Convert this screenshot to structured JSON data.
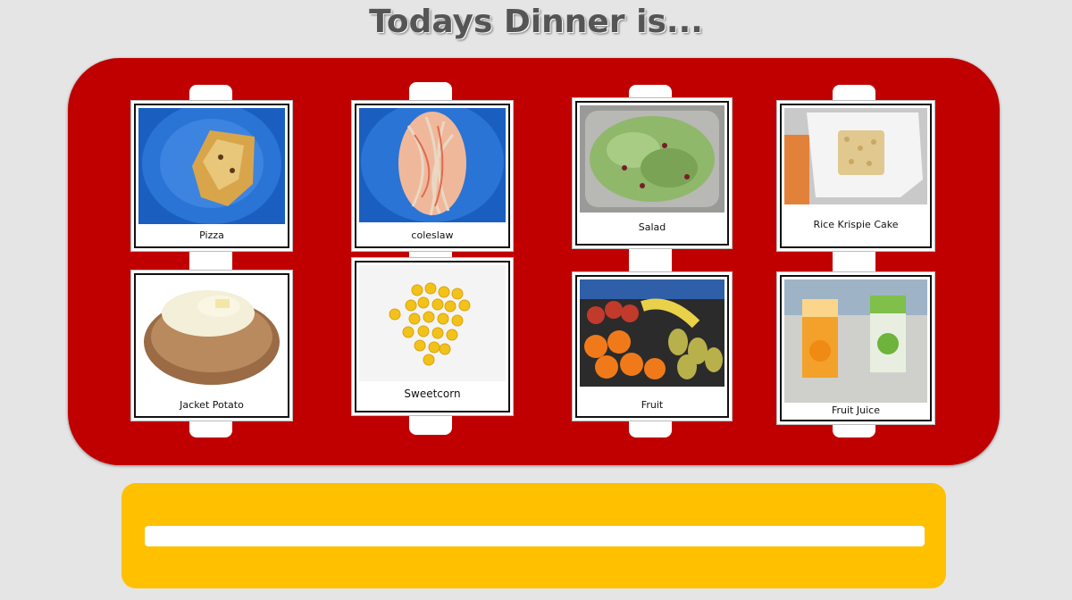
{
  "header": {
    "title": "Todays Dinner is..."
  },
  "menu": {
    "items": [
      {
        "label": "Pizza",
        "icon": "pizza-photo"
      },
      {
        "label": "coleslaw",
        "icon": "coleslaw-photo"
      },
      {
        "label": "Salad",
        "icon": "salad-photo"
      },
      {
        "label": "Rice Krispie Cake",
        "icon": "rice-krispie-cake-photo"
      },
      {
        "label": "Jacket Potato",
        "icon": "jacket-potato-photo"
      },
      {
        "label": "Sweetcorn",
        "icon": "sweetcorn-photo"
      },
      {
        "label": "Fruit",
        "icon": "fruit-photo"
      },
      {
        "label": "Fruit Juice",
        "icon": "fruit-juice-photo"
      }
    ]
  },
  "colors": {
    "board": "#c00000",
    "tray": "#ffc000",
    "background": "#e5e5e5"
  }
}
